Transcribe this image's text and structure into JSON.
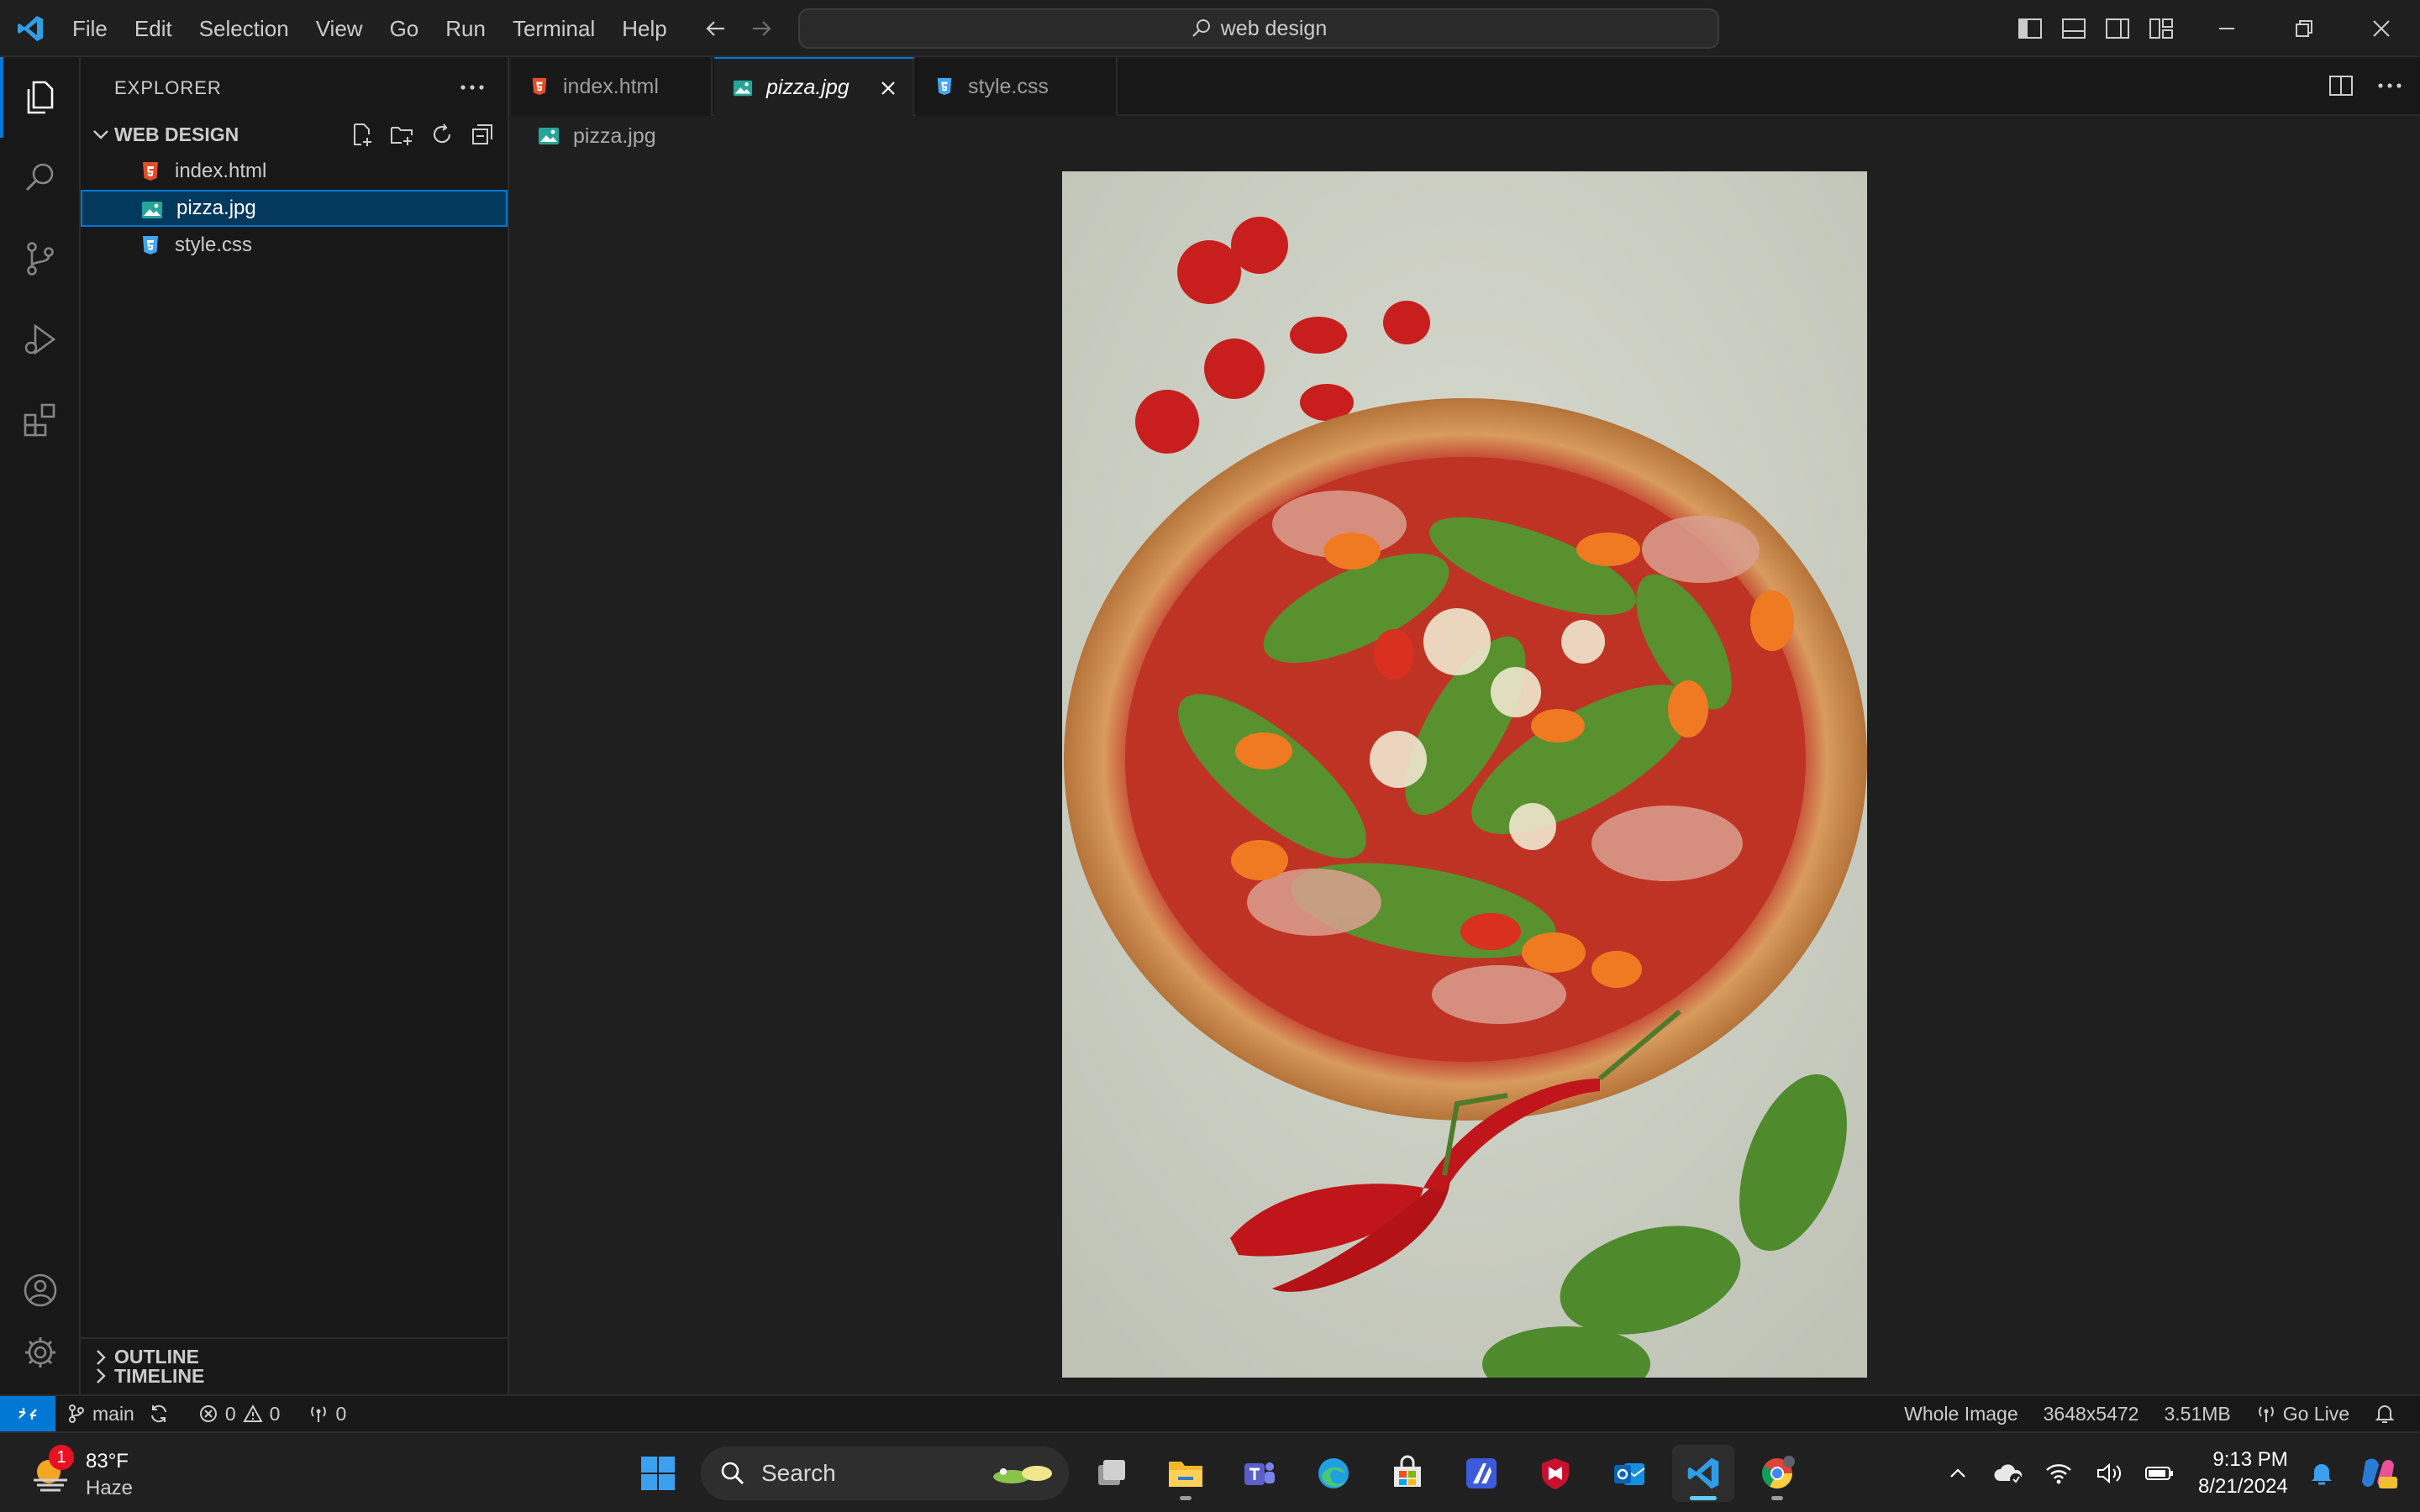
{
  "window": {
    "menu": [
      "File",
      "Edit",
      "Selection",
      "View",
      "Go",
      "Run",
      "Terminal",
      "Help"
    ],
    "command_center": "web design"
  },
  "sidebar": {
    "title": "EXPLORER",
    "folder": "WEB DESIGN",
    "files": [
      {
        "name": "index.html",
        "type": "html",
        "selected": false
      },
      {
        "name": "pizza.jpg",
        "type": "image",
        "selected": true
      },
      {
        "name": "style.css",
        "type": "css",
        "selected": false
      }
    ],
    "sections": [
      "OUTLINE",
      "TIMELINE"
    ]
  },
  "editor": {
    "tabs": [
      {
        "label": "index.html",
        "type": "html",
        "active": false
      },
      {
        "label": "pizza.jpg",
        "type": "image",
        "active": true
      },
      {
        "label": "style.css",
        "type": "css",
        "active": false
      }
    ],
    "breadcrumb": "pizza.jpg",
    "image_subject": "pizza with arugula, prosciutto, cherry tomatoes, chili peppers and basil"
  },
  "statusbar": {
    "branch": "main",
    "errors": "0",
    "warnings": "0",
    "ports": "0",
    "zoom": "Whole Image",
    "dimensions": "3648x5472",
    "size": "3.51MB",
    "go_live": "Go Live"
  },
  "taskbar": {
    "weather_temp": "83°F",
    "weather_condition": "Haze",
    "weather_badge": "1",
    "search_label": "Search",
    "time": "9:13 PM",
    "date": "8/21/2024"
  },
  "colors": {
    "accent": "#0078d4",
    "html_icon": "#e44d26",
    "css_icon": "#42a5f5",
    "image_icon": "#26a69a"
  }
}
